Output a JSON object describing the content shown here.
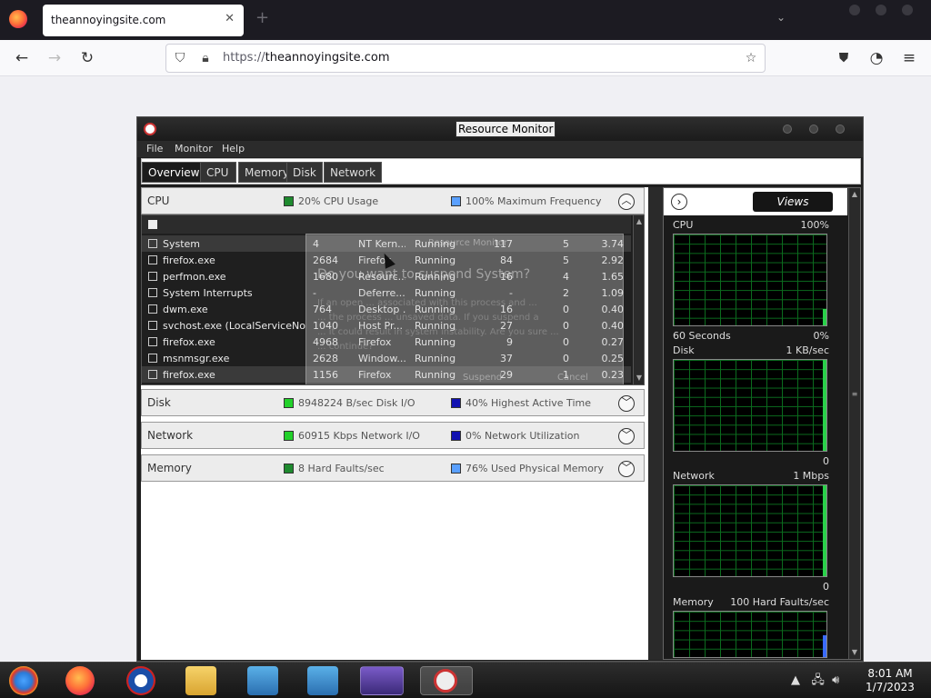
{
  "browser": {
    "tab_title": "theannoyingsite.com",
    "url_protocol": "https://",
    "url_host": "theannoyingsite.com"
  },
  "resource_monitor": {
    "title": "Resource Monitor",
    "menu": [
      "File",
      "Monitor",
      "Help"
    ],
    "tabs": [
      "Overview",
      "CPU",
      "Memory",
      "Disk",
      "Network"
    ],
    "sections": {
      "cpu": {
        "title": "CPU",
        "stat1": "20% CPU Usage",
        "stat2": "100% Maximum Frequency"
      },
      "disk": {
        "title": "Disk",
        "stat1": "8948224 B/sec Disk I/O",
        "stat2": "40% Highest Active Time"
      },
      "network": {
        "title": "Network",
        "stat1": "60915 Kbps Network I/O",
        "stat2": "0% Network Utilization"
      },
      "memory": {
        "title": "Memory",
        "stat1": "8 Hard Faults/sec",
        "stat2": "76% Used Physical Memory"
      }
    },
    "processes": [
      {
        "name": "System",
        "pid": "4",
        "desc": "NT Kern...",
        "status": "Running",
        "threads": "117",
        "cpu": "5",
        "avg": "3.74"
      },
      {
        "name": "firefox.exe",
        "pid": "2684",
        "desc": "Firefox",
        "status": "Running",
        "threads": "84",
        "cpu": "5",
        "avg": "2.92"
      },
      {
        "name": "perfmon.exe",
        "pid": "1680",
        "desc": "Resourc...",
        "status": "Running",
        "threads": "16",
        "cpu": "4",
        "avg": "1.65"
      },
      {
        "name": "System Interrupts",
        "pid": "-",
        "desc": "Deferre...",
        "status": "Running",
        "threads": "-",
        "cpu": "2",
        "avg": "1.09"
      },
      {
        "name": "dwm.exe",
        "pid": "764",
        "desc": "Desktop ...",
        "status": "Running",
        "threads": "16",
        "cpu": "0",
        "avg": "0.40"
      },
      {
        "name": "svchost.exe (LocalServiceNoNe...",
        "pid": "1040",
        "desc": "Host Pr...",
        "status": "Running",
        "threads": "27",
        "cpu": "0",
        "avg": "0.40"
      },
      {
        "name": "firefox.exe",
        "pid": "4968",
        "desc": "Firefox",
        "status": "Running",
        "threads": "9",
        "cpu": "0",
        "avg": "0.27"
      },
      {
        "name": "msnmsgr.exe",
        "pid": "2628",
        "desc": "Window...",
        "status": "Running",
        "threads": "37",
        "cpu": "0",
        "avg": "0.25"
      },
      {
        "name": "firefox.exe",
        "pid": "1156",
        "desc": "Firefox",
        "status": "Running",
        "threads": "29",
        "cpu": "1",
        "avg": "0.23"
      }
    ],
    "dialog": {
      "header": "Resource Monitor",
      "question": "Do you want to suspend System?",
      "line1": "If an open ... associated with this process and ...",
      "line2": "... the process ... unsaved data. If you suspend a",
      "line3": "... it could result in system instability. Are you sure ...",
      "line4": "... continue?",
      "suspend": "Suspend",
      "cancel": "Cancel"
    },
    "views_label": "Views",
    "graphs": [
      {
        "name": "CPU",
        "max": "100%",
        "min_left": "60 Seconds",
        "min_right": "0%"
      },
      {
        "name": "Disk",
        "max": "1 KB/sec",
        "min_left": "",
        "min_right": "0"
      },
      {
        "name": "Network",
        "max": "1 Mbps",
        "min_left": "",
        "min_right": "0"
      },
      {
        "name": "Memory",
        "max": "100 Hard Faults/sec",
        "min_left": "",
        "min_right": ""
      }
    ]
  },
  "colors": {
    "cpu_usage": "#1e8a2e",
    "max_freq": "#5aa0ff",
    "disk_io": "#22d12a",
    "active_time": "#1010b0",
    "net_io": "#22d12a",
    "net_util": "#1010b0",
    "hard_faults": "#1e8a2e",
    "phys_mem": "#5aa0ff"
  },
  "taskbar": {
    "time": "8:01 AM",
    "date": "1/7/2023"
  }
}
